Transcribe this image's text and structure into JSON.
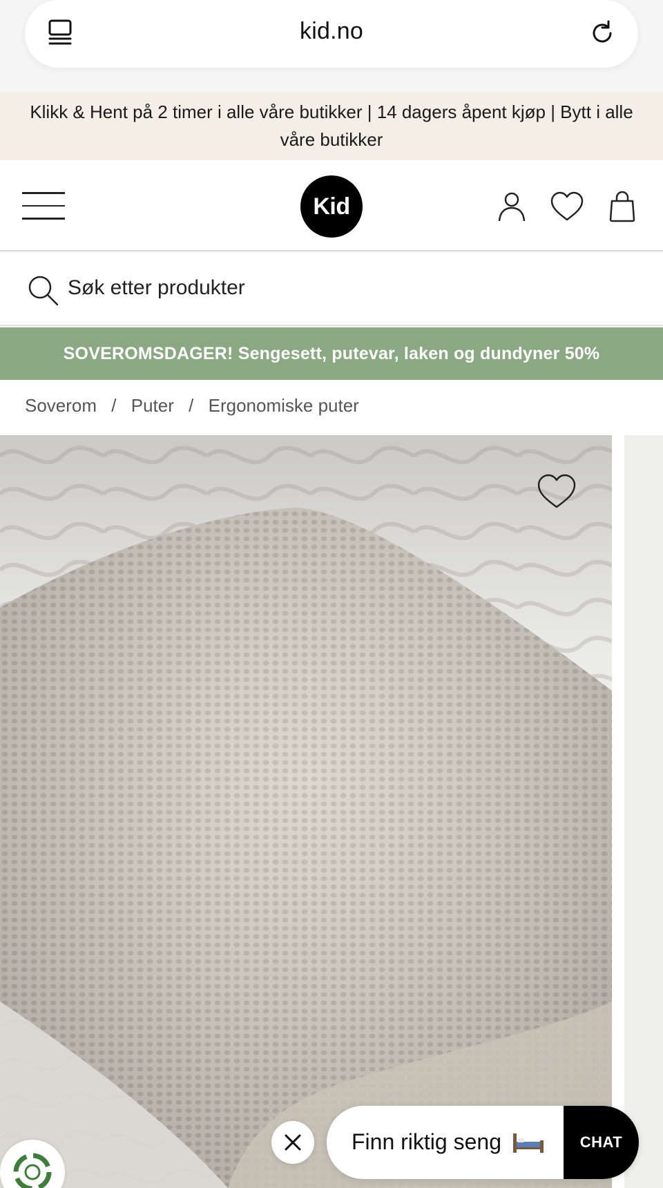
{
  "browser": {
    "url": "kid.no",
    "tabs_icon": "tabs-icon",
    "reload_icon": "reload-icon"
  },
  "announcement": {
    "text": "Klikk & Hent på 2 timer i alle våre butikker | 14 dagers åpent kjøp | Bytt i alle våre butikker"
  },
  "header": {
    "menu_icon": "hamburger-menu-icon",
    "logo_text": "Kid",
    "account_icon": "user-icon",
    "wishlist_icon": "heart-icon",
    "cart_icon": "shopping-bag-icon"
  },
  "search": {
    "placeholder": "Søk etter produkter",
    "icon": "search-icon"
  },
  "promo": {
    "text": "SOVEROMSDAGER! Sengesett, putevar, laken og dundyner 50%",
    "background": "#8aa882"
  },
  "breadcrumb": {
    "items": [
      "Soverom",
      "Puter",
      "Ergonomiske puter"
    ],
    "separator": "/"
  },
  "product": {
    "wishlist_icon": "heart-outline-icon"
  },
  "floating": {
    "close_icon": "close-icon",
    "finder_label": "Finn riktig seng",
    "finder_icon": "bed-icon",
    "chat_label": "CHAT",
    "eco_icon": "recycle-badge-icon"
  }
}
